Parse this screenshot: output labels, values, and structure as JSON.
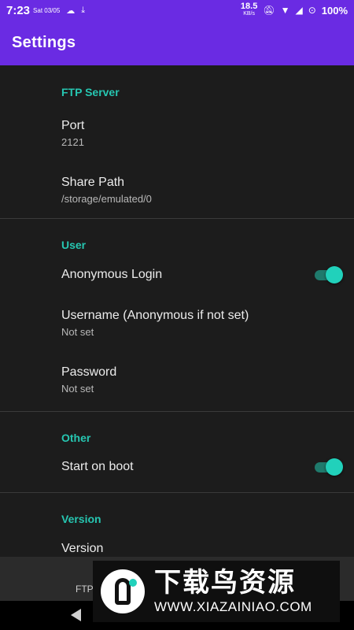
{
  "status_bar": {
    "time": "7:23",
    "date": "Sat 03/05",
    "speed_value": "18.5",
    "speed_unit": "KB/s",
    "battery": "100%"
  },
  "app_bar": {
    "title": "Settings"
  },
  "sections": [
    {
      "title": "FTP Server",
      "items": [
        {
          "title": "Port",
          "summary": "2121"
        },
        {
          "title": "Share Path",
          "summary": "/storage/emulated/0"
        }
      ]
    },
    {
      "title": "User",
      "items": [
        {
          "title": "Anonymous Login",
          "switch_on": true
        },
        {
          "title": "Username (Anonymous if not set)",
          "summary": "Not set"
        },
        {
          "title": "Password",
          "summary": "Not set"
        }
      ]
    },
    {
      "title": "Other",
      "items": [
        {
          "title": "Start on boot",
          "switch_on": true
        }
      ]
    },
    {
      "title": "Version",
      "items": [
        {
          "title": "Version"
        }
      ]
    }
  ],
  "bottom": {
    "text": "FTP"
  },
  "watermark": {
    "cn": "下载鸟资源",
    "url": "WWW.XIAZAINIAO.COM"
  },
  "colors": {
    "accent": "#26c6b1",
    "app_bar": "#6a2be3",
    "background": "#1c1c1c"
  }
}
